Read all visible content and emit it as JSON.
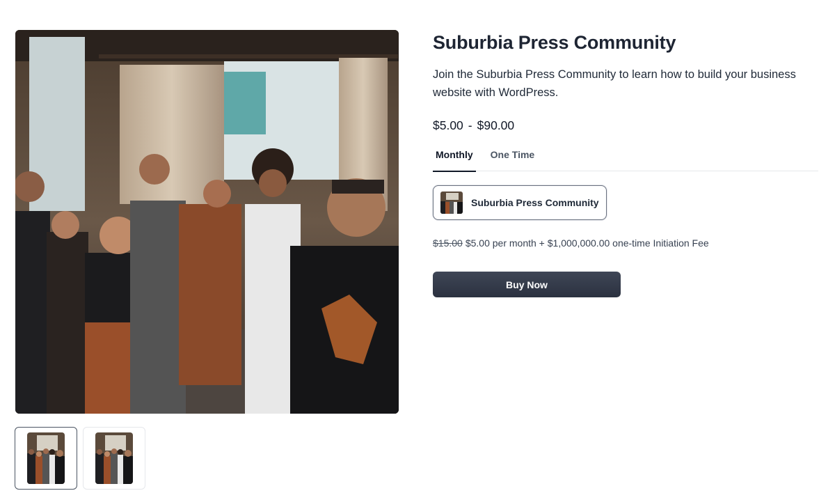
{
  "product": {
    "title": "Suburbia Press Community",
    "description": "Join the Suburbia Press Community to learn how to build your business website with WordPress.",
    "price_min": "$5.00",
    "price_sep": "-",
    "price_max": "$90.00"
  },
  "tabs": [
    {
      "label": "Monthly",
      "active": true
    },
    {
      "label": "One Time",
      "active": false
    }
  ],
  "option": {
    "label": "Suburbia Press Community"
  },
  "pricing": {
    "old_price": "$15.00",
    "details": "$5.00 per month + $1,000,000.00 one-time Initiation Fee"
  },
  "buy_button": {
    "label": "Buy Now"
  },
  "gallery": {
    "thumbnail_count": 2,
    "active_thumbnail": 0
  },
  "colors": {
    "button": "#2f3545",
    "title": "#1e2533"
  }
}
